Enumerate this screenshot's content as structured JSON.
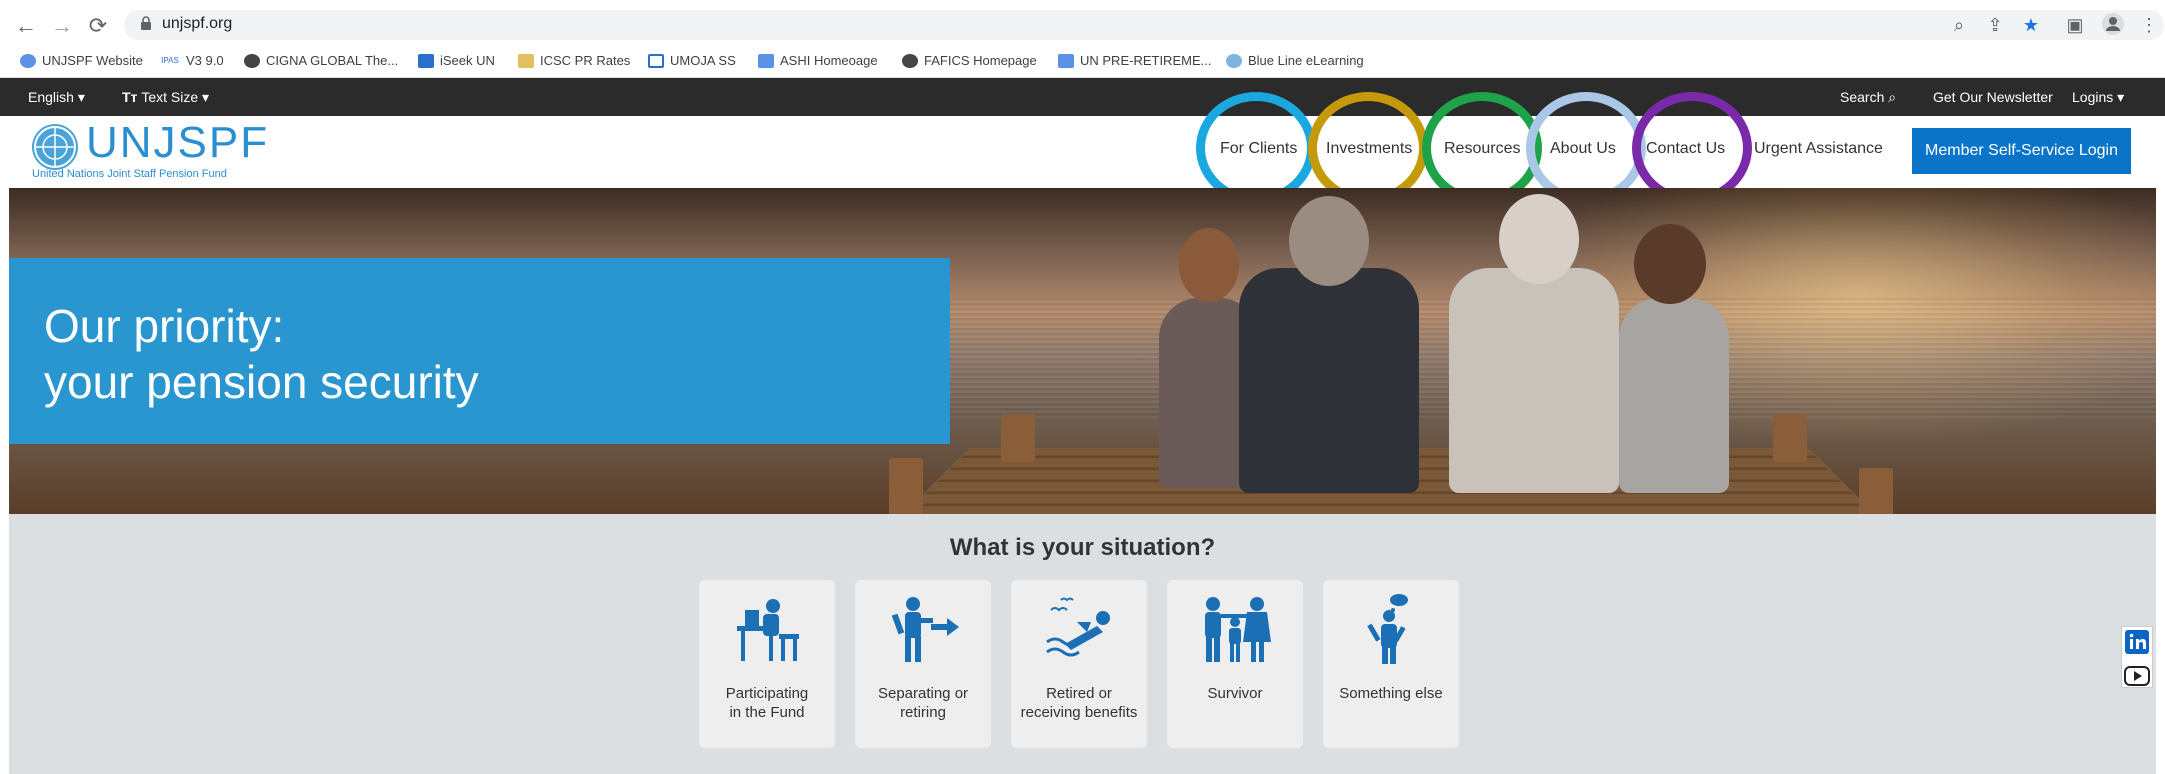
{
  "browser": {
    "url": "unjspf.org",
    "bookmarks": [
      {
        "label": "UNJSPF Website",
        "icon": "un-icon"
      },
      {
        "label": "V3 9.0",
        "icon": "ipas-icon"
      },
      {
        "label": "CIGNA GLOBAL The...",
        "icon": "globe-icon"
      },
      {
        "label": "iSeek UN",
        "icon": "un-icon"
      },
      {
        "label": "ICSC PR Rates",
        "icon": "icsc-icon"
      },
      {
        "label": "UMOJA SS",
        "icon": "umoja-icon"
      },
      {
        "label": "ASHI Homeoage",
        "icon": "un-icon"
      },
      {
        "label": "FAFICS Homepage",
        "icon": "globe-icon"
      },
      {
        "label": "UN PRE-RETIREME...",
        "icon": "un-icon"
      },
      {
        "label": "Blue Line eLearning",
        "icon": "blueline-icon"
      }
    ]
  },
  "utility": {
    "language": "English",
    "text_size": "Text Size",
    "search": "Search",
    "newsletter": "Get Our Newsletter",
    "logins": "Logins"
  },
  "header": {
    "logo_title": "UNJSPF",
    "logo_subtitle": "United Nations Joint Staff Pension Fund",
    "nav": [
      {
        "label": "For Clients",
        "ring_color": "#1aa8e0"
      },
      {
        "label": "Investments",
        "ring_color": "#c49a0a"
      },
      {
        "label": "Resources",
        "ring_color": "#1ea34a"
      },
      {
        "label": "About Us",
        "ring_color": "#a9c7e6"
      },
      {
        "label": "Contact Us",
        "ring_color": "#7a2aa8"
      },
      {
        "label": "Urgent Assistance",
        "ring_color": null
      }
    ],
    "login_button": "Member Self-Service Login",
    "accent_color": "#0a74c9"
  },
  "hero": {
    "line1": "Our priority:",
    "line2": "your pension security",
    "panel_color": "#2a96d0"
  },
  "situation": {
    "title": "What is your situation?",
    "cards": [
      {
        "line1": "Participating",
        "line2": "in the Fund",
        "icon": "desk-worker-icon"
      },
      {
        "line1": "Separating or",
        "line2": "retiring",
        "icon": "person-exit-icon"
      },
      {
        "line1": "Retired or",
        "line2": "receiving benefits",
        "icon": "relaxing-person-icon"
      },
      {
        "line1": "Survivor",
        "line2": "",
        "icon": "family-icon"
      },
      {
        "line1": "Something else",
        "line2": "",
        "icon": "thinking-person-icon"
      }
    ],
    "icon_color": "#1b6fb5"
  }
}
